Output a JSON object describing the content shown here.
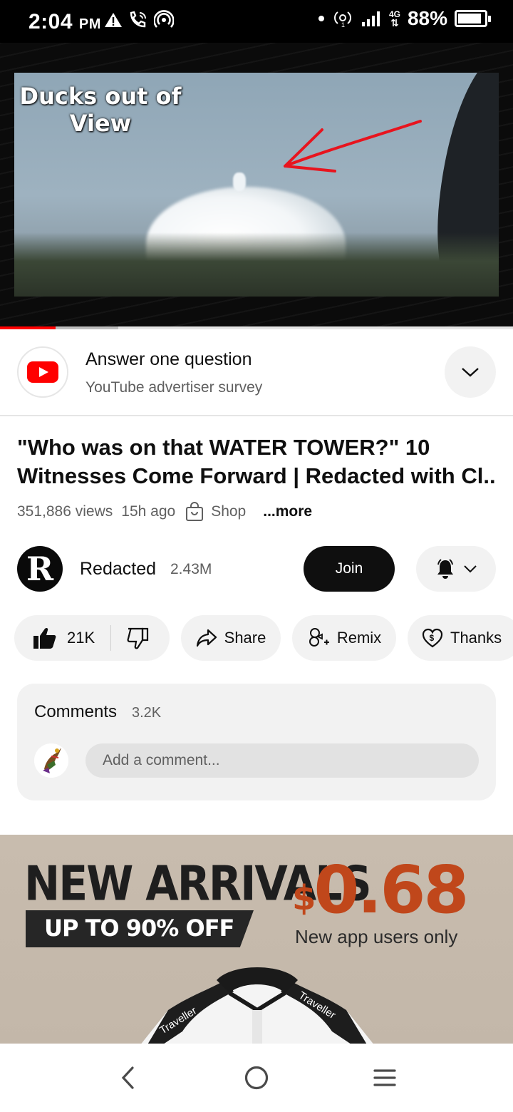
{
  "status_bar": {
    "time": "2:04",
    "ampm": "PM",
    "network": "4G",
    "battery": "88%",
    "battery_level": 0.88,
    "icons": [
      "warning-icon",
      "wifi-calling-icon",
      "hotspot-icon",
      "dot-icon",
      "signal-icon",
      "battery-icon"
    ]
  },
  "video": {
    "caption": "Ducks out of View",
    "progress_played": 0.108,
    "progress_buffered": 0.23,
    "colors": {
      "arrow": "#e8141e",
      "progress": "#ff0000"
    }
  },
  "survey": {
    "title": "Answer one question",
    "subtitle": "YouTube advertiser survey"
  },
  "video_info": {
    "title": "\"Who was on that WATER TOWER?\" 10 Witnesses Come Forward | Redacted with Cl..",
    "views": "351,886 views",
    "age": "15h ago",
    "shop": "Shop",
    "more": "...more"
  },
  "channel": {
    "avatar_letter": "R",
    "name": "Redacted",
    "subscribers": "2.43M",
    "join_label": "Join"
  },
  "actions": {
    "likes": "21K",
    "share": "Share",
    "remix": "Remix",
    "thanks": "Thanks"
  },
  "comments": {
    "label": "Comments",
    "count": "3.2K",
    "placeholder": "Add a comment..."
  },
  "ad": {
    "headline": "NEW ARRIVALS",
    "band": "UP TO 90% OFF",
    "currency": "$",
    "price": "0.68",
    "note": "New app users only",
    "brand_text": "Traveller",
    "colors": {
      "price": "#c0471b"
    }
  },
  "nav": [
    "back-icon",
    "home-icon",
    "recents-icon"
  ]
}
